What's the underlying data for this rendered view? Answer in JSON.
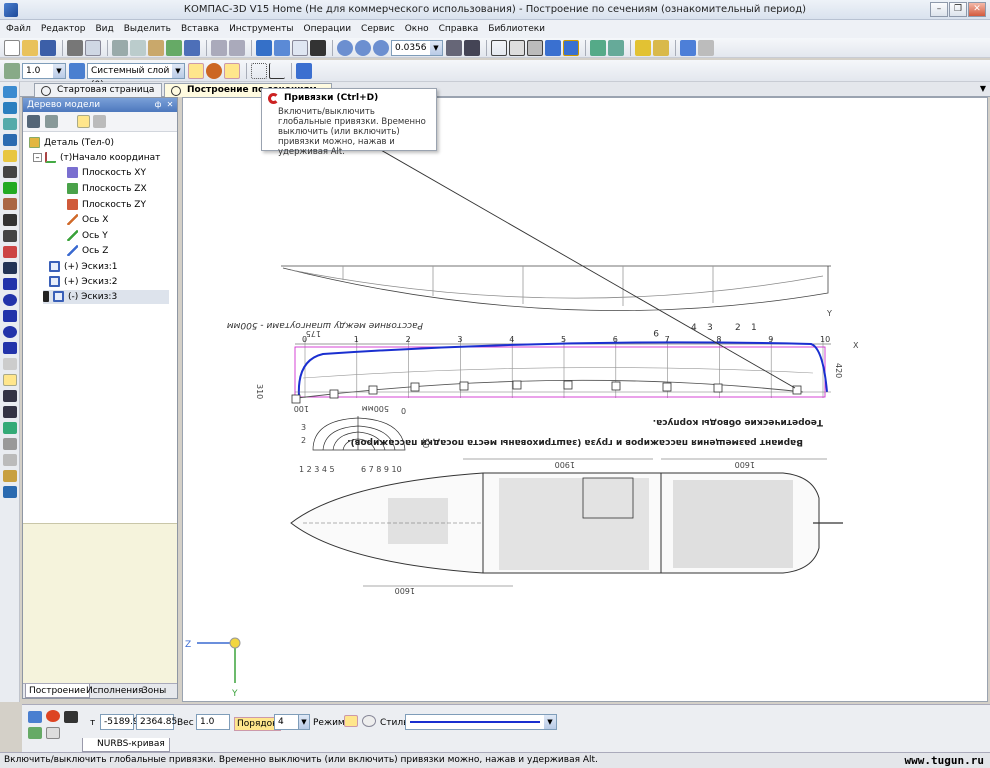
{
  "window": {
    "title": "КОМПАС-3D V15 Home (Не для коммерческого использования) - Построение по сечениям (ознакомительный период)",
    "minimize": "–",
    "restore": "❐",
    "close": "✕"
  },
  "menu": [
    "Файл",
    "Редактор",
    "Вид",
    "Выделить",
    "Вставка",
    "Инструменты",
    "Операции",
    "Сервис",
    "Окно",
    "Справка",
    "Библиотеки"
  ],
  "toolbar1": {
    "scale_value": "0.0356"
  },
  "toolbar2": {
    "step_value": "1.0",
    "layer_value": "Системный слой (0)"
  },
  "tabs": [
    {
      "label": "Стартовая страница"
    },
    {
      "label": "Построение по сечениям"
    }
  ],
  "tree": {
    "header": "Дерево модели",
    "pin": "ф",
    "close": "✕",
    "items": [
      {
        "label": "Деталь (Тел-0)"
      },
      {
        "label": "(т)Начало координат"
      },
      {
        "label": "Плоскость XY"
      },
      {
        "label": "Плоскость ZX"
      },
      {
        "label": "Плоскость ZY"
      },
      {
        "label": "Ось X"
      },
      {
        "label": "Ось Y"
      },
      {
        "label": "Ось Z"
      },
      {
        "label": "(+) Эскиз:1"
      },
      {
        "label": "(+) Эскиз:2"
      },
      {
        "label": "(-) Эскиз:3"
      }
    ],
    "tabs": [
      "Построение",
      "Исполнения",
      "Зоны"
    ]
  },
  "tooltip": {
    "title": "Привязки (Ctrl+D)",
    "body": "Включить/выключить глобальные привязки. Временно выключить (или включить) привязки можно, нажав и удерживая Alt."
  },
  "drawing": {
    "label_spacing": "Расстояние между шпангоутами - 500мм",
    "label_theory": "Теоретические обводы корпуса.",
    "label_variant": "Вариант размещения пассажиров и груза (заштрихованы места посадки пассажиров).",
    "stations_top": [
      "0",
      "1",
      "2",
      "3",
      "4",
      "5",
      "6",
      "7",
      "8",
      "9",
      "10"
    ],
    "stations_upper": [
      "1",
      "2",
      "3",
      "4",
      "9"
    ],
    "dim_175": "175",
    "dim_100": "100",
    "dim_500": "500мм",
    "dim_0": "0",
    "dim_310": "310",
    "dim_420": "420",
    "dim_50": "50",
    "dim_1900": "1900",
    "dim_1600a": "1600",
    "dim_1600b": "1600",
    "dim_1600c": "1600",
    "sections_left": "1 2 3 4 5",
    "sections_right": "6 7 8 9 10",
    "section_num_2": "2",
    "section_num_3": "3",
    "axis_x": "X",
    "axis_y": "Y",
    "axis_z": "Z"
  },
  "props": {
    "t_label": "т",
    "coord_x": "-5189.9",
    "coord_y": "2364.85",
    "weight_label": "Вес",
    "weight_value": "1.0",
    "order_label": "Порядок",
    "order_value": "4",
    "mode_label": "Режим",
    "style_label": "Стиль",
    "tab_label": "NURBS-кривая"
  },
  "status": {
    "text": "Включить/выключить глобальные привязки. Временно выключить (или включить) привязки можно, нажав и удерживая Alt.",
    "watermark": "www.tugun.ru"
  },
  "colors": {
    "accent_blue": "#1a2fd0",
    "selection_magenta": "#d030d0",
    "tab_active": "#fffbe0"
  }
}
